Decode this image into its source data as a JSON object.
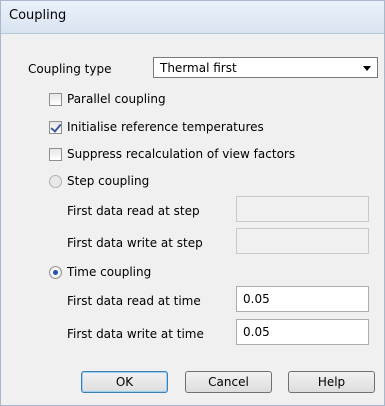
{
  "window": {
    "title": "Coupling"
  },
  "coupling_type": {
    "label": "Coupling type",
    "value": "Thermal first"
  },
  "checkboxes": [
    {
      "label": "Parallel coupling",
      "checked": false
    },
    {
      "label": "Initialise reference temperatures",
      "checked": true
    },
    {
      "label": "Suppress recalculation of view factors",
      "checked": false
    }
  ],
  "step_coupling": {
    "label": "Step coupling",
    "selected": false,
    "read_label": "First data read at step",
    "read_value": "",
    "write_label": "First data write at step",
    "write_value": ""
  },
  "time_coupling": {
    "label": "Time coupling",
    "selected": true,
    "read_label": "First data read at time",
    "read_value": "0.05",
    "write_label": "First data write at time",
    "write_value": "0.05"
  },
  "buttons": {
    "ok": "OK",
    "cancel": "Cancel",
    "help": "Help"
  }
}
